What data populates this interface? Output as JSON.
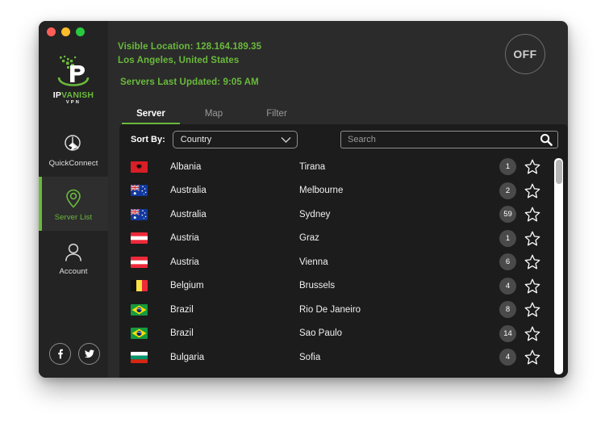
{
  "window": {
    "traffic_lights": [
      "close",
      "minimize",
      "maximize"
    ]
  },
  "sidebar": {
    "logo": {
      "ip": "IP",
      "vanish": "VANISH",
      "sub": "VPN"
    },
    "items": [
      {
        "label": "QuickConnect",
        "icon": "quickconnect-icon",
        "active": false
      },
      {
        "label": "Server List",
        "icon": "location-pin-icon",
        "active": true
      },
      {
        "label": "Account",
        "icon": "user-icon",
        "active": false
      }
    ],
    "socials": [
      {
        "label": "Facebook",
        "icon": "facebook-icon"
      },
      {
        "label": "Twitter",
        "icon": "twitter-icon"
      }
    ]
  },
  "header": {
    "visible_location": "Visible Location: 128.164.189.35",
    "location_name": "Los Angeles, United States",
    "servers_updated": "Servers Last Updated: 9:05 AM",
    "power_label": "OFF",
    "accent_color": "#6aba3c"
  },
  "tabs": [
    {
      "label": "Server",
      "active": true
    },
    {
      "label": "Map",
      "active": false
    },
    {
      "label": "Filter",
      "active": false
    }
  ],
  "toolbar": {
    "sort_label": "Sort By:",
    "sort_value": "Country",
    "sort_options": [
      "Country"
    ],
    "search_placeholder": "Search",
    "search_value": ""
  },
  "server_list": {
    "rows": [
      {
        "country": "Albania",
        "city": "Tirana",
        "count": "1",
        "flag": "al",
        "favorite": false
      },
      {
        "country": "Australia",
        "city": "Melbourne",
        "count": "2",
        "flag": "au",
        "favorite": false
      },
      {
        "country": "Australia",
        "city": "Sydney",
        "count": "59",
        "flag": "au",
        "favorite": false
      },
      {
        "country": "Austria",
        "city": "Graz",
        "count": "1",
        "flag": "at",
        "favorite": false
      },
      {
        "country": "Austria",
        "city": "Vienna",
        "count": "6",
        "flag": "at",
        "favorite": false
      },
      {
        "country": "Belgium",
        "city": "Brussels",
        "count": "4",
        "flag": "be",
        "favorite": false
      },
      {
        "country": "Brazil",
        "city": "Rio De Janeiro",
        "count": "8",
        "flag": "br",
        "favorite": false
      },
      {
        "country": "Brazil",
        "city": "Sao Paulo",
        "count": "14",
        "flag": "br",
        "favorite": false
      },
      {
        "country": "Bulgaria",
        "city": "Sofia",
        "count": "4",
        "flag": "bg",
        "favorite": false
      }
    ]
  }
}
